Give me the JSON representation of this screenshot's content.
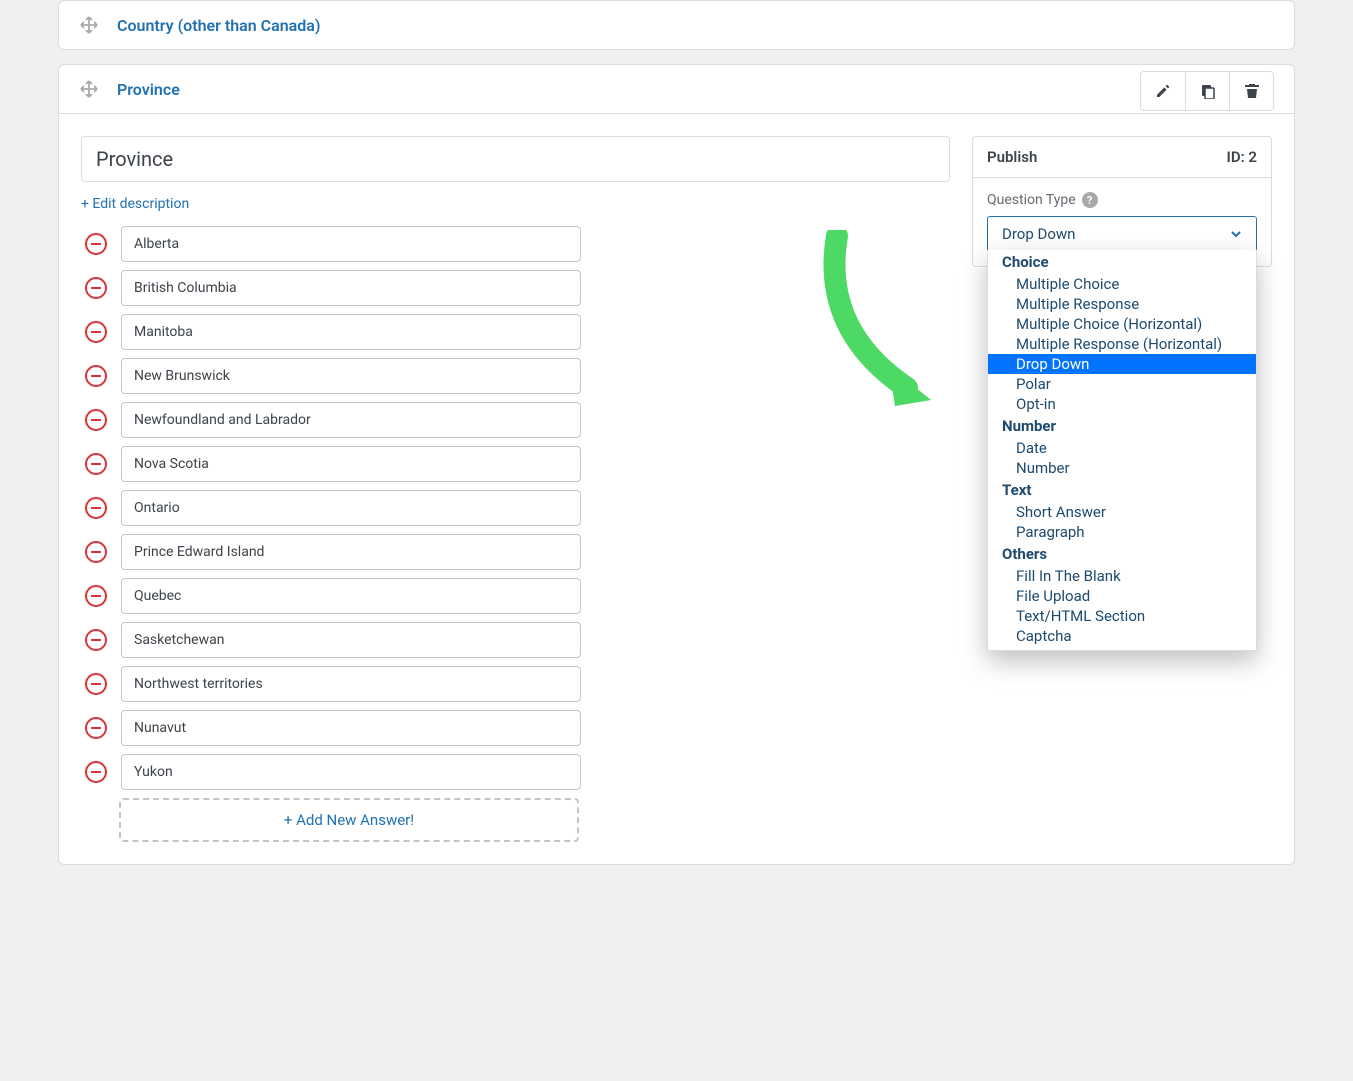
{
  "cards": [
    {
      "title": "Country (other than Canada)"
    },
    {
      "title": "Province"
    }
  ],
  "question": {
    "title_value": "Province",
    "edit_description": "+ Edit description",
    "answers": [
      "Alberta",
      "British Columbia",
      "Manitoba",
      "New Brunswick",
      "Newfoundland and Labrador",
      "Nova Scotia",
      "Ontario",
      "Prince Edward Island",
      "Quebec",
      "Sasketchewan",
      "Northwest territories",
      "Nunavut",
      "Yukon"
    ],
    "add_answer_label": "+ Add New Answer!"
  },
  "publish": {
    "title": "Publish",
    "id_label": "ID: 2",
    "question_type_label": "Question Type",
    "selected_type": "Drop Down",
    "groups": [
      {
        "label": "Choice",
        "items": [
          "Multiple Choice",
          "Multiple Response",
          "Multiple Choice (Horizontal)",
          "Multiple Response (Horizontal)",
          "Drop Down",
          "Polar",
          "Opt-in"
        ]
      },
      {
        "label": "Number",
        "items": [
          "Date",
          "Number"
        ]
      },
      {
        "label": "Text",
        "items": [
          "Short Answer",
          "Paragraph"
        ]
      },
      {
        "label": "Others",
        "items": [
          "Fill In The Blank",
          "File Upload",
          "Text/HTML Section",
          "Captcha"
        ]
      }
    ]
  }
}
